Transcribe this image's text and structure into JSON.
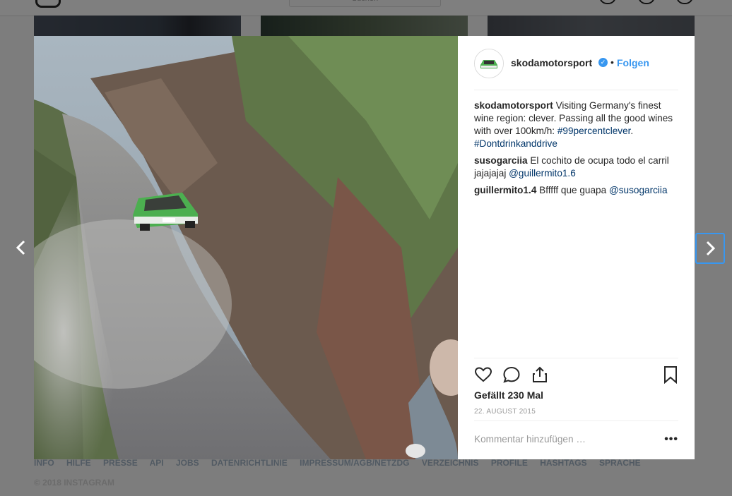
{
  "header": {
    "search_placeholder": "Suchen"
  },
  "post": {
    "username": "skodamotorsport",
    "verified_icon": "verified-check-icon",
    "dot": "•",
    "follow_label": "Folgen",
    "caption": {
      "user": "skodamotorsport",
      "text": "Visiting Germany's finest wine region: clever. Passing all the good wines with over 100km/h: ",
      "hashtag1": "#99percentclever",
      "after": ". ",
      "hashtag2": "#Dontdrinkanddrive"
    },
    "comments": [
      {
        "user": "susogarciia",
        "text": "El cochito de ocupa todo el carril jajajajaj ",
        "mention": "@guillermito1.6"
      },
      {
        "user": "guillermito1.4",
        "text": "Bfffff que guapa ",
        "mention": "@susogarciia"
      }
    ],
    "likes": "Gefällt 230 Mal",
    "date": "22. AUGUST 2015",
    "add_comment_placeholder": "Kommentar hinzufügen …",
    "more_label": "•••",
    "icons": [
      "heart-icon",
      "comment-icon",
      "share-icon",
      "bookmark-icon"
    ]
  },
  "nav": {
    "prev": "‹",
    "next": "›"
  },
  "footer": {
    "links": [
      "INFO",
      "HILFE",
      "PRESSE",
      "API",
      "JOBS",
      "DATENRICHTLINIE",
      "IMPRESSUM/AGB/NETZDG",
      "VERZEICHNIS",
      "PROFILE",
      "HASHTAGS",
      "SPRACHE"
    ],
    "copyright": "© 2018 INSTAGRAM"
  },
  "colors": {
    "accent": "#3897f0",
    "link": "#003569",
    "car": "#4caf50"
  }
}
